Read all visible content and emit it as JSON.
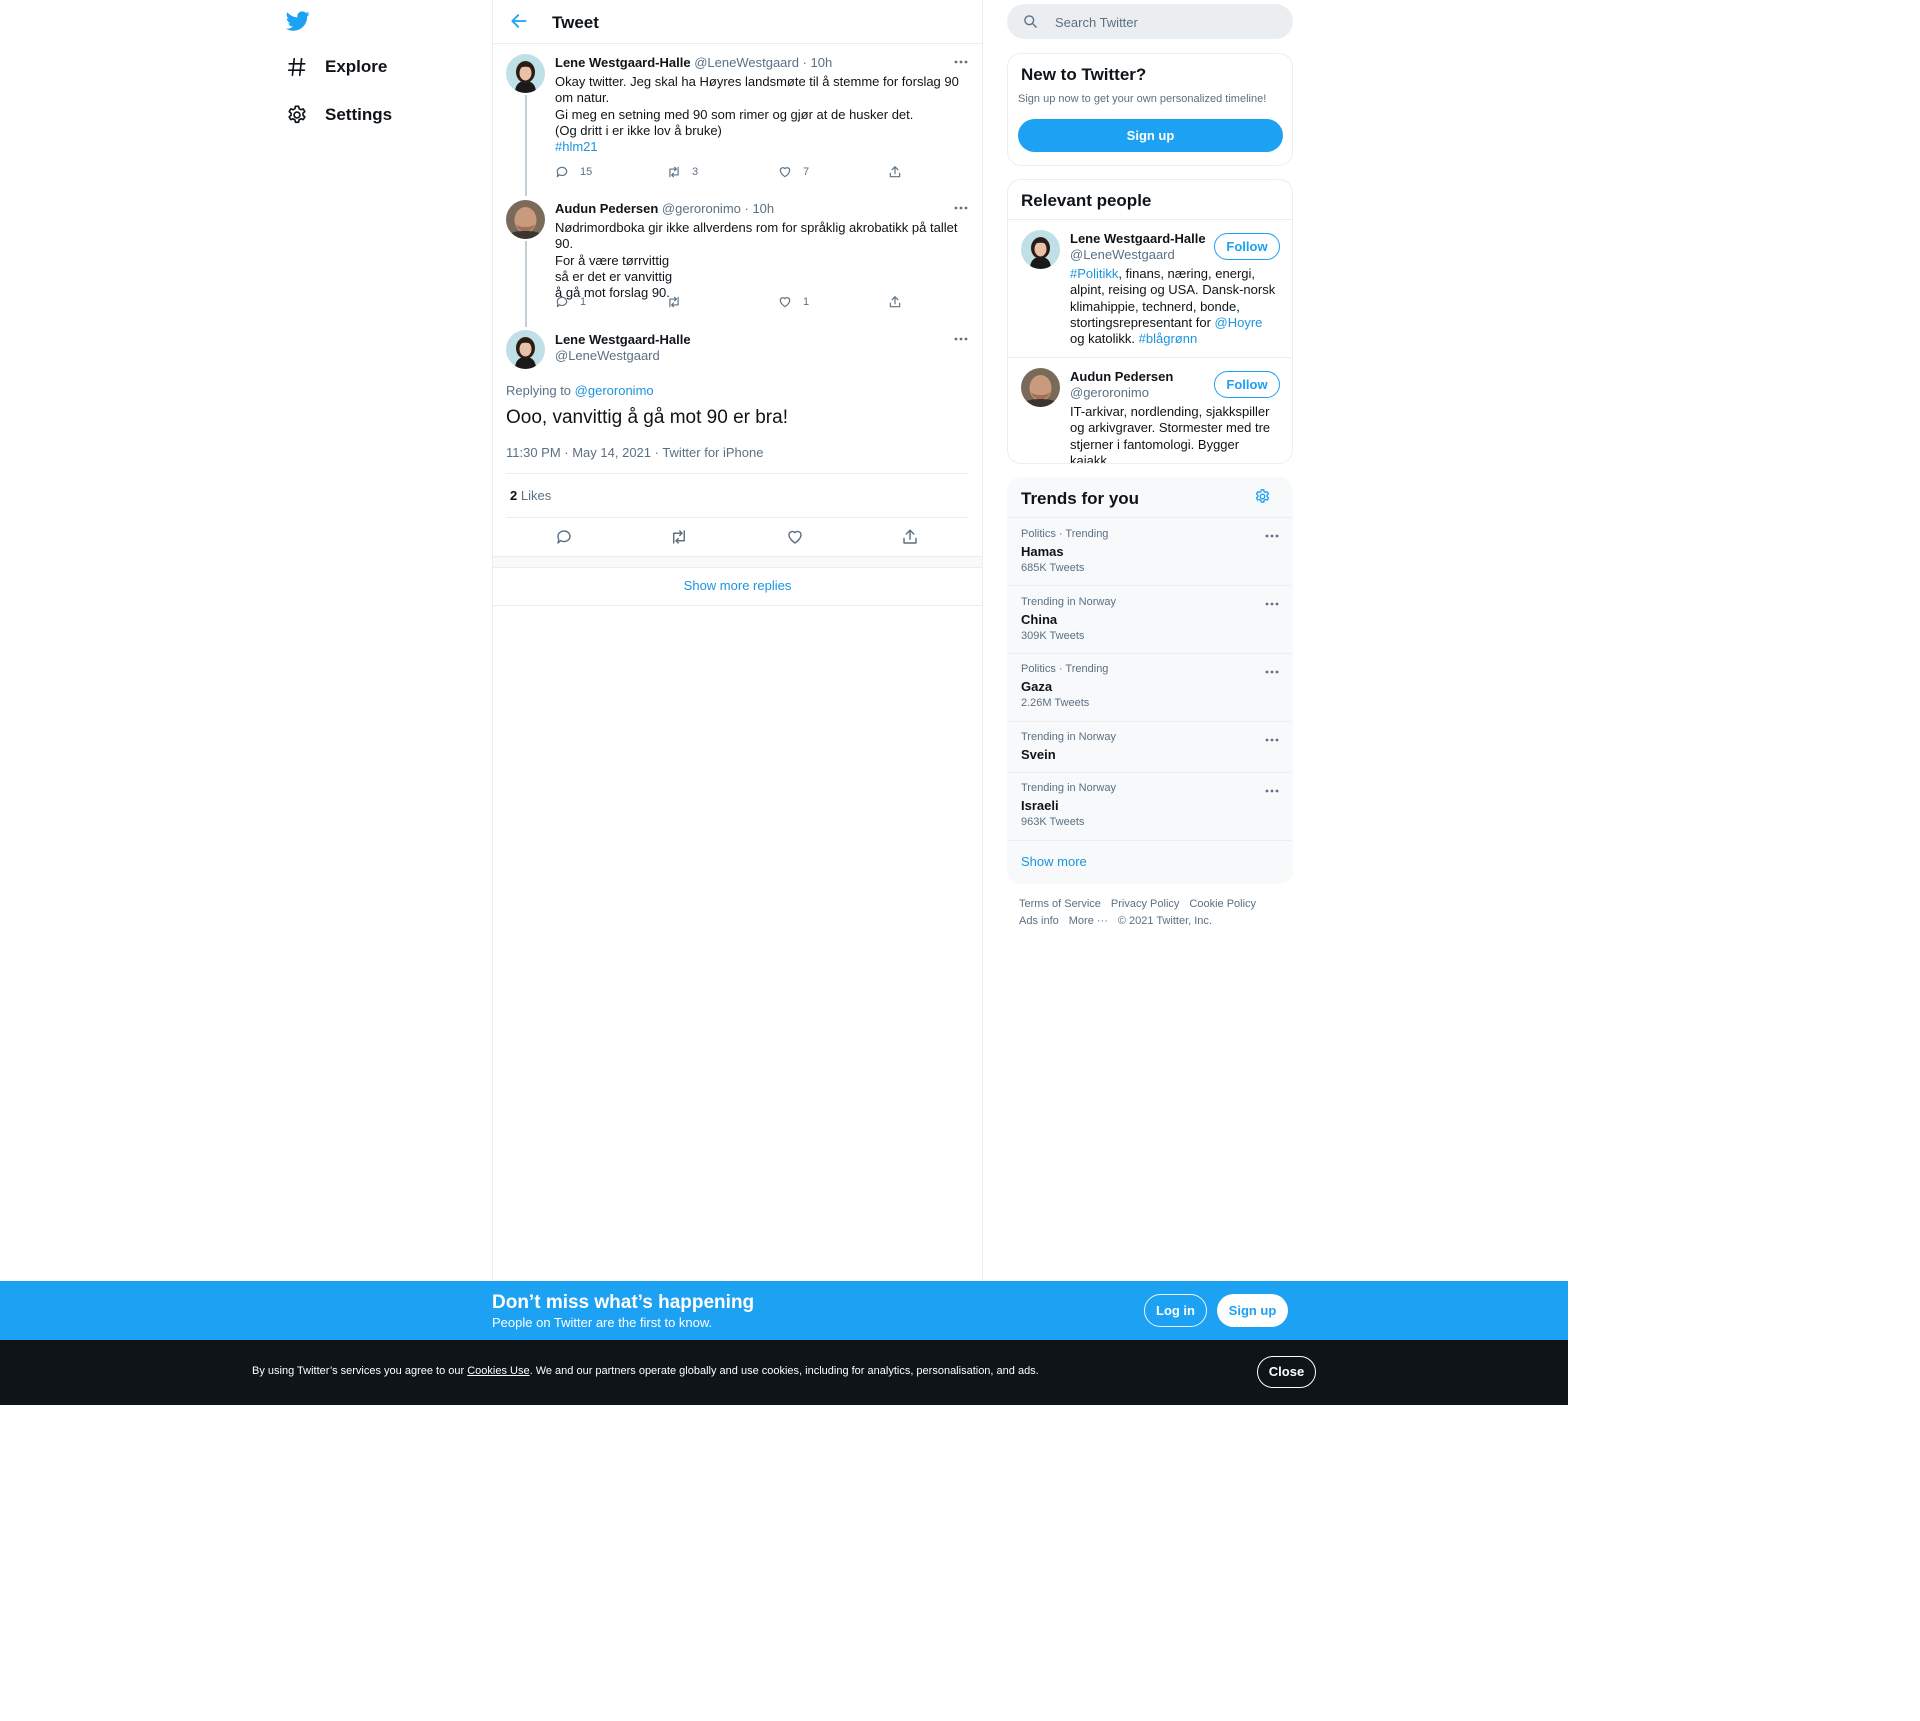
{
  "nav": {
    "explore_label": "Explore",
    "settings_label": "Settings"
  },
  "header": {
    "title": "Tweet"
  },
  "thread": [
    {
      "name": "Lene Westgaard-Halle",
      "handle": "@LeneWestgaard",
      "time": "10h",
      "text": "Okay twitter. Jeg skal ha Høyres landsmøte til å stemme for forslag 90 om natur.\nGi meg en setning med 90 som rimer og gjør at de husker det.\n(Og dritt i er ikke lov å bruke)",
      "hashtag": "#hlm21",
      "replies": "15",
      "retweets": "3",
      "likes": "7"
    },
    {
      "name": "Audun Pedersen",
      "handle": "@geroronimo",
      "time": "10h",
      "text": "Nødrimordboka gir ikke allverdens rom for språklig akrobatikk på tallet 90.\nFor å være tørrvittig\nså er det er vanvittig\nå gå mot forslag 90.",
      "replies": "1",
      "retweets": "",
      "likes": "1"
    }
  ],
  "focus": {
    "name": "Lene Westgaard-Halle",
    "handle": "@LeneWestgaard",
    "replying_prefix": "Replying to",
    "replying_to": "@geroronimo",
    "text": "Ooo, vanvittig å gå mot 90 er bra!",
    "meta": "11:30 PM · May 14, 2021 · Twitter for iPhone",
    "likes_count": "2",
    "likes_label": "Likes"
  },
  "show_more_replies": "Show more replies",
  "search": {
    "placeholder": "Search Twitter"
  },
  "signup_card": {
    "title": "New to Twitter?",
    "subtitle": "Sign up now to get your own personalized timeline!",
    "button": "Sign up"
  },
  "relevant_people": {
    "title": "Relevant people",
    "follow_label": "Follow",
    "people": [
      {
        "name": "Lene Westgaard-Halle",
        "handle": "@LeneWestgaard",
        "bio_tag": "#Politikk",
        "bio_text": ", finans, næring, energi, alpint, reising og USA. Dansk-norsk klimahippie, technerd, bonde, stortingsrepresentant for ",
        "bio_mention": "@Hoyre",
        "bio_text2": " og katolikk. ",
        "bio_tag2": "#blågrønn"
      },
      {
        "name": "Audun Pedersen",
        "handle": "@geroronimo",
        "bio": "IT-arkivar, nordlending, sjakkspiller og arkivgraver. Stormester med tre stjerner i fantomologi. Bygger kajakk."
      }
    ]
  },
  "trends": {
    "title": "Trends for you",
    "items": [
      {
        "context": "Politics · Trending",
        "name": "Hamas",
        "count": "685K Tweets"
      },
      {
        "context": "Trending in Norway",
        "name": "China",
        "count": "309K Tweets"
      },
      {
        "context": "Politics · Trending",
        "name": "Gaza",
        "count": "2.26M Tweets"
      },
      {
        "context": "Trending in Norway",
        "name": "Svein",
        "count": ""
      },
      {
        "context": "Trending in Norway",
        "name": "Israeli",
        "count": "963K Tweets"
      }
    ],
    "show_more": "Show more"
  },
  "footer": {
    "terms": "Terms of Service",
    "privacy": "Privacy Policy",
    "cookie": "Cookie Policy",
    "ads": "Ads info",
    "more": "More ···",
    "copyright": "© 2021 Twitter, Inc."
  },
  "banner": {
    "title": "Don’t miss what’s happening",
    "subtitle": "People on Twitter are the first to know.",
    "login": "Log in",
    "signup": "Sign up"
  },
  "cookie_bar": {
    "prefix": "By using Twitter’s services you agree to our ",
    "link": "Cookies Use",
    "suffix": ". We and our partners operate globally and use cookies, including for analytics, personalisation, and ads.",
    "close": "Close"
  },
  "colors": {
    "brand": "#1da1f2",
    "link": "#1b95e0",
    "text": "#0f1419",
    "muted": "#5b7083",
    "cookie_bg": "#0f1419"
  }
}
